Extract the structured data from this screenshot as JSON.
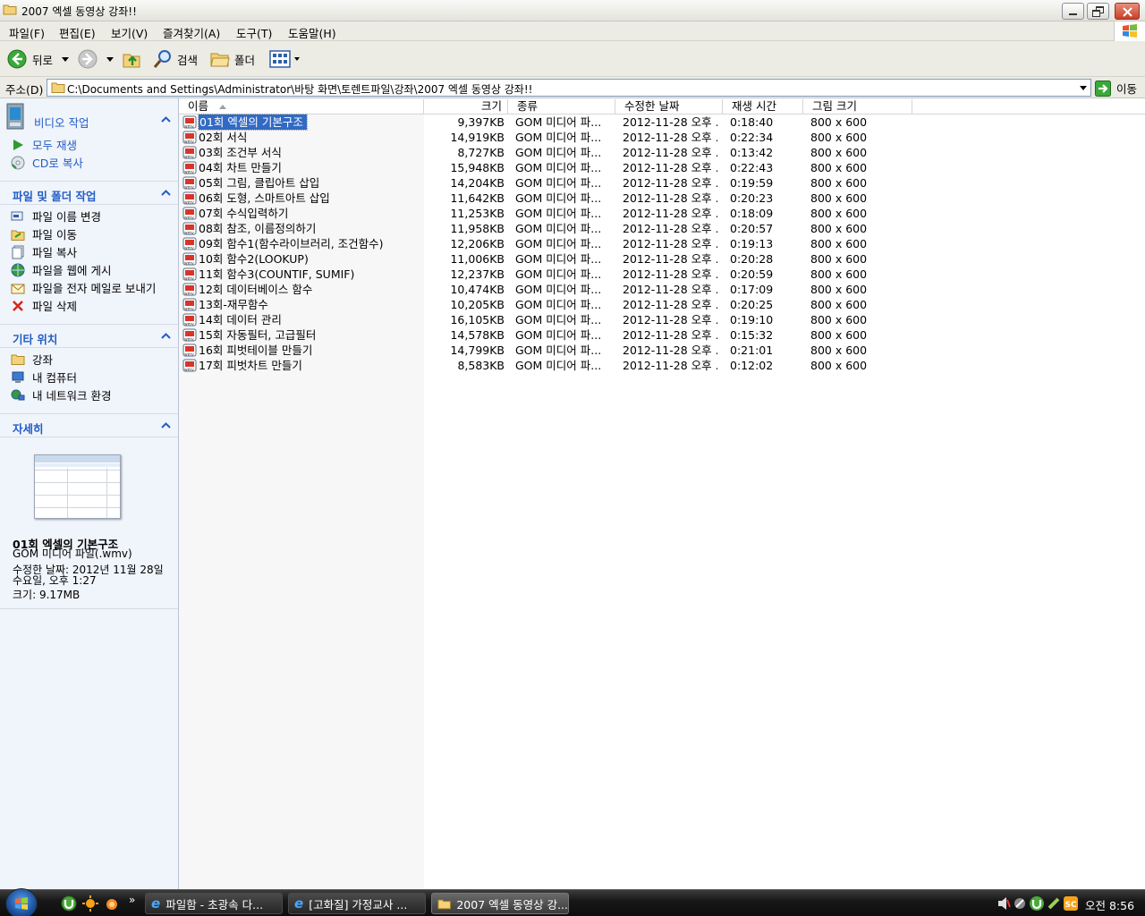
{
  "window": {
    "title": "2007 엑셀 동영상 강좌!!"
  },
  "menu": [
    "파일(F)",
    "편집(E)",
    "보기(V)",
    "즐겨찾기(A)",
    "도구(T)",
    "도움말(H)"
  ],
  "toolbar": {
    "back": "뒤로",
    "search": "검색",
    "folders": "폴더"
  },
  "address": {
    "label": "주소(D)",
    "path": "C:\\Documents and Settings\\Administrator\\바탕 화면\\토렌트파일\\강좌\\2007 엑셀 동영상 강좌!!",
    "go": "이동"
  },
  "sidebar": {
    "video": {
      "title": "비디오 작업",
      "items": [
        "모두 재생",
        "CD로 복사"
      ]
    },
    "file": {
      "title": "파일 및 폴더 작업",
      "items": [
        "파일 이름 변경",
        "파일 이동",
        "파일 복사",
        "파일을 웹에 게시",
        "파일을 전자 메일로 보내기",
        "파일 삭제"
      ]
    },
    "other": {
      "title": "기타 위치",
      "items": [
        "강좌",
        "내 컴퓨터",
        "내 네트워크 환경"
      ]
    },
    "details": {
      "title": "자세히",
      "name": "01회 엑셀의 기본구조",
      "type": "GOM 미디어 파일(.wmv)",
      "modified_line1": "수정한 날짜: 2012년 11월 28일",
      "modified_line2": "수요일, 오후 1:27",
      "size": "크기: 9.17MB"
    }
  },
  "columns": {
    "name": "이름",
    "size": "크기",
    "type": "종류",
    "modified": "수정한 날짜",
    "duration": "재생 시간",
    "dimensions": "그림 크기"
  },
  "files": [
    {
      "name": "01회 엑셀의 기본구조",
      "size": "9,397KB",
      "type": "GOM 미디어 파...",
      "date": "2012-11-28 오후 ...",
      "duration": "0:18:40",
      "dim": "800 x 600"
    },
    {
      "name": "02회 서식",
      "size": "14,919KB",
      "type": "GOM 미디어 파...",
      "date": "2012-11-28 오후 ...",
      "duration": "0:22:34",
      "dim": "800 x 600"
    },
    {
      "name": "03회 조건부 서식",
      "size": "8,727KB",
      "type": "GOM 미디어 파...",
      "date": "2012-11-28 오후 ...",
      "duration": "0:13:42",
      "dim": "800 x 600"
    },
    {
      "name": "04회 차트 만들기",
      "size": "15,948KB",
      "type": "GOM 미디어 파...",
      "date": "2012-11-28 오후 ...",
      "duration": "0:22:43",
      "dim": "800 x 600"
    },
    {
      "name": "05회 그림, 클립아트 삽입",
      "size": "14,204KB",
      "type": "GOM 미디어 파...",
      "date": "2012-11-28 오후 ...",
      "duration": "0:19:59",
      "dim": "800 x 600"
    },
    {
      "name": "06회 도형, 스마트아트 삽입",
      "size": "11,642KB",
      "type": "GOM 미디어 파...",
      "date": "2012-11-28 오후 ...",
      "duration": "0:20:23",
      "dim": "800 x 600"
    },
    {
      "name": "07회 수식입력하기",
      "size": "11,253KB",
      "type": "GOM 미디어 파...",
      "date": "2012-11-28 오후 ...",
      "duration": "0:18:09",
      "dim": "800 x 600"
    },
    {
      "name": "08회 참조, 이름정의하기",
      "size": "11,958KB",
      "type": "GOM 미디어 파...",
      "date": "2012-11-28 오후 ...",
      "duration": "0:20:57",
      "dim": "800 x 600"
    },
    {
      "name": "09회 함수1(함수라이브러리, 조건함수)",
      "size": "12,206KB",
      "type": "GOM 미디어 파...",
      "date": "2012-11-28 오후 ...",
      "duration": "0:19:13",
      "dim": "800 x 600"
    },
    {
      "name": "10회 함수2(LOOKUP)",
      "size": "11,006KB",
      "type": "GOM 미디어 파...",
      "date": "2012-11-28 오후 ...",
      "duration": "0:20:28",
      "dim": "800 x 600"
    },
    {
      "name": "11회 함수3(COUNTIF, SUMIF)",
      "size": "12,237KB",
      "type": "GOM 미디어 파...",
      "date": "2012-11-28 오후 ...",
      "duration": "0:20:59",
      "dim": "800 x 600"
    },
    {
      "name": "12회 데이터베이스 함수",
      "size": "10,474KB",
      "type": "GOM 미디어 파...",
      "date": "2012-11-28 오후 ...",
      "duration": "0:17:09",
      "dim": "800 x 600"
    },
    {
      "name": "13회-재무함수",
      "size": "10,205KB",
      "type": "GOM 미디어 파...",
      "date": "2012-11-28 오후 ...",
      "duration": "0:20:25",
      "dim": "800 x 600"
    },
    {
      "name": "14회 데이터 관리",
      "size": "16,105KB",
      "type": "GOM 미디어 파...",
      "date": "2012-11-28 오후 ...",
      "duration": "0:19:10",
      "dim": "800 x 600"
    },
    {
      "name": "15회 자동필터, 고급필터",
      "size": "14,578KB",
      "type": "GOM 미디어 파...",
      "date": "2012-11-28 오후 ...",
      "duration": "0:15:32",
      "dim": "800 x 600"
    },
    {
      "name": "16회 피벗테이블 만들기",
      "size": "14,799KB",
      "type": "GOM 미디어 파...",
      "date": "2012-11-28 오후 ...",
      "duration": "0:21:01",
      "dim": "800 x 600"
    },
    {
      "name": "17회 피벗차트 만들기",
      "size": "8,583KB",
      "type": "GOM 미디어 파...",
      "date": "2012-11-28 오후 ...",
      "duration": "0:12:02",
      "dim": "800 x 600"
    }
  ],
  "taskbar": {
    "buttons": [
      "파일함 - 초광속 다...",
      "[고화질] 가정교사 ...",
      "2007 엑셀 동영상 강..."
    ],
    "clock": "오전 8:56"
  },
  "colors": {
    "link": "#215dc6",
    "selection": "#316ac5",
    "sidebar_bg": "#f0f4fb"
  }
}
